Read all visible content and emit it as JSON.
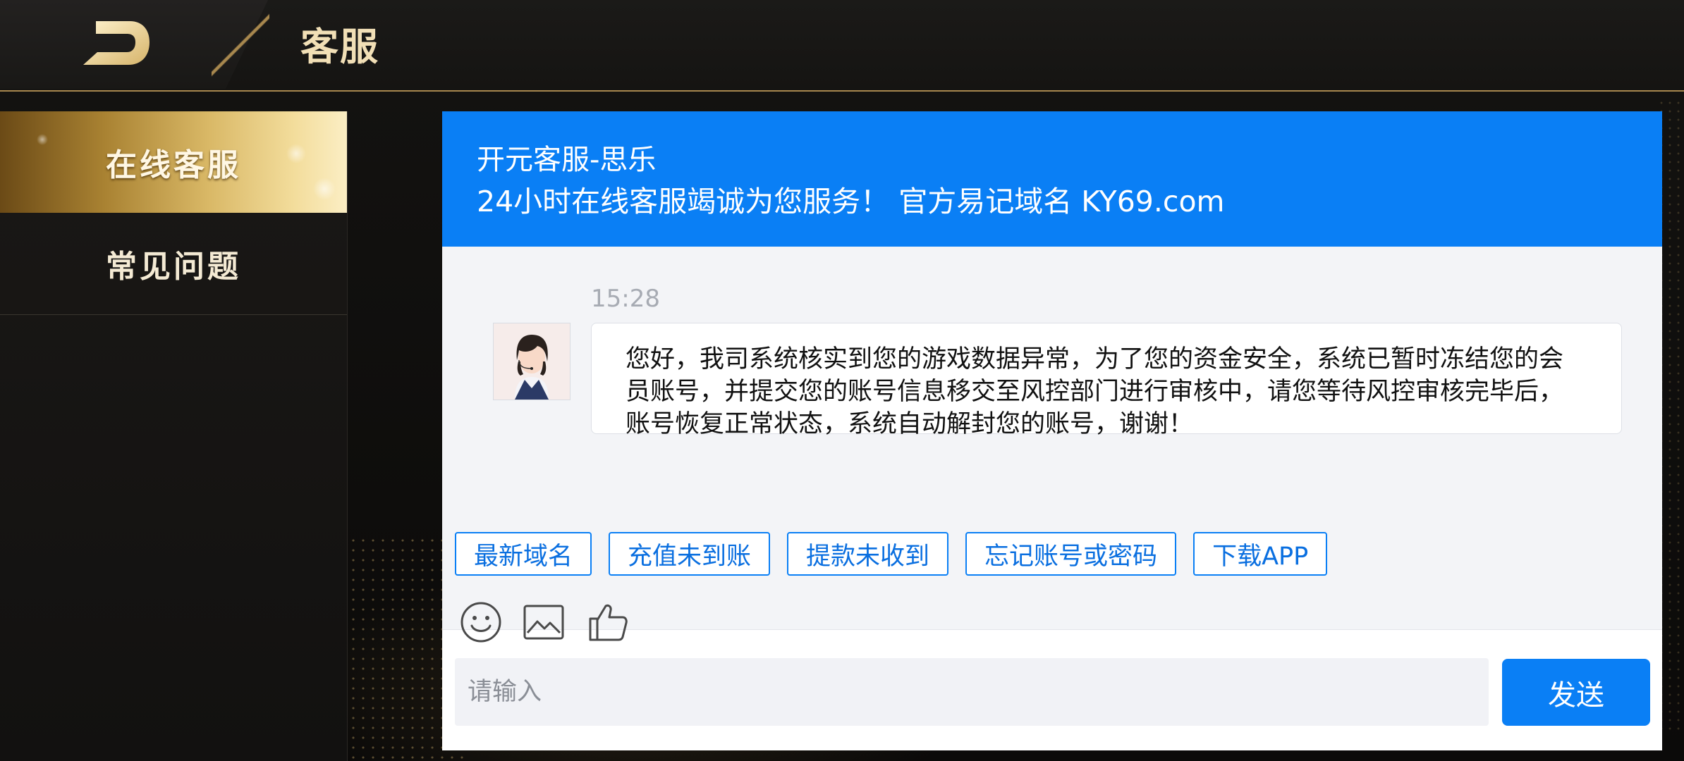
{
  "header": {
    "title": "客服",
    "back_icon": "back-arrow-icon"
  },
  "sidebar": {
    "items": [
      {
        "label": "在线客服",
        "active": true
      },
      {
        "label": "常见问题",
        "active": false
      }
    ]
  },
  "chat": {
    "agent_name": "开元客服-思乐",
    "subtitle": "24小时在线客服竭诚为您服务！  官方易记域名 KY69.com",
    "messages": [
      {
        "time": "15:28",
        "avatar": "agent-avatar",
        "text": "您好，我司系统核实到您的游戏数据异常，为了您的资金安全，系统已暂时冻结您的会员账号，并提交您的账号信息移交至风控部门进行审核中，请您等待风控审核完毕后，账号恢复正常状态，系统自动解封您的账号，谢谢！"
      }
    ],
    "quick_replies": [
      "最新域名",
      "充值未到账",
      "提款未收到",
      "忘记账号或密码",
      "下载APP"
    ],
    "tools": [
      "emoji-icon",
      "image-icon",
      "thumbs-up-icon"
    ],
    "input_placeholder": "请输入",
    "send_label": "发送"
  },
  "colors": {
    "accent_blue": "#0a7ff5",
    "gold": "#d9b866",
    "header_text": "#f1dfb6"
  }
}
